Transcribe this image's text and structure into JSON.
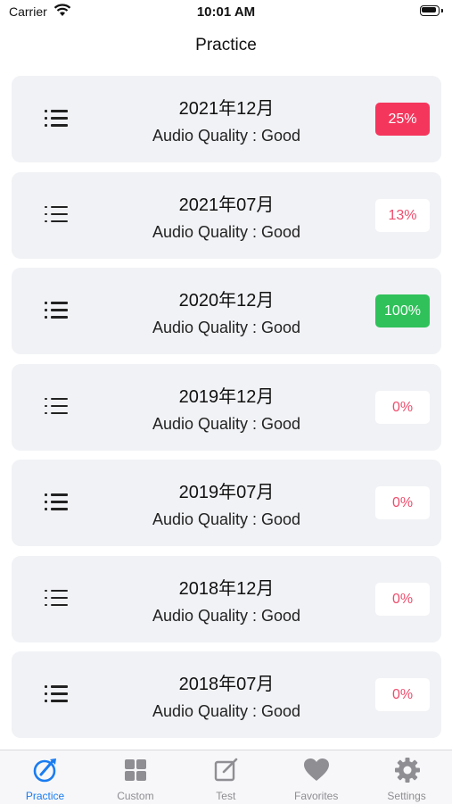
{
  "status_bar": {
    "carrier": "Carrier",
    "time": "10:01 AM"
  },
  "nav": {
    "title": "Practice"
  },
  "rows": [
    {
      "title": "2021年12月",
      "subtitle": "Audio Quality : Good",
      "progress": "25%",
      "badge_style": "red"
    },
    {
      "title": "2021年07月",
      "subtitle": "Audio Quality : Good",
      "progress": "13%",
      "badge_style": "white"
    },
    {
      "title": "2020年12月",
      "subtitle": "Audio Quality : Good",
      "progress": "100%",
      "badge_style": "green"
    },
    {
      "title": "2019年12月",
      "subtitle": "Audio Quality : Good",
      "progress": "0%",
      "badge_style": "white"
    },
    {
      "title": "2019年07月",
      "subtitle": "Audio Quality : Good",
      "progress": "0%",
      "badge_style": "white"
    },
    {
      "title": "2018年12月",
      "subtitle": "Audio Quality : Good",
      "progress": "0%",
      "badge_style": "white"
    },
    {
      "title": "2018年07月",
      "subtitle": "Audio Quality : Good",
      "progress": "0%",
      "badge_style": "white"
    }
  ],
  "tabs": [
    {
      "label": "Practice",
      "icon": "practice-icon",
      "active": true
    },
    {
      "label": "Custom",
      "icon": "grid-icon",
      "active": false
    },
    {
      "label": "Test",
      "icon": "edit-icon",
      "active": false
    },
    {
      "label": "Favorites",
      "icon": "heart-icon",
      "active": false
    },
    {
      "label": "Settings",
      "icon": "gear-icon",
      "active": false
    }
  ],
  "colors": {
    "accent": "#1a7cf0",
    "red": "#f5365c",
    "green": "#30c15a",
    "inactive": "#8e8e93"
  }
}
